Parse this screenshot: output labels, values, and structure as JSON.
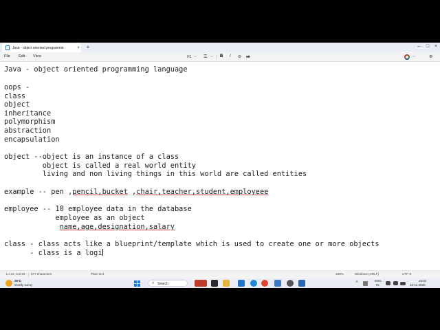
{
  "window": {
    "tab_title": "Java - object oriented programmir",
    "tab_close": "×",
    "new_tab": "+",
    "minimize": "–",
    "maximize": "□",
    "close": "×"
  },
  "menu": {
    "items": [
      "File",
      "Edit",
      "View"
    ],
    "heading_select": "H1",
    "chevron": "⌵",
    "bullet_list": "☰",
    "bold": "B",
    "italic": "I",
    "link": "⊖",
    "strikethrough": "ab",
    "settings": "⚙"
  },
  "editor": {
    "lines": [
      {
        "text": "Java - object oriented programming language",
        "row": 0,
        "indent": 0
      },
      {
        "text": "oops -",
        "row": 2,
        "indent": 0
      },
      {
        "text": "class",
        "row": 3,
        "indent": 0
      },
      {
        "text": "object",
        "row": 4,
        "indent": 0
      },
      {
        "text": "inheritance",
        "row": 5,
        "indent": 0
      },
      {
        "text": "polymorphism",
        "row": 6,
        "indent": 0
      },
      {
        "text": "abstraction",
        "row": 7,
        "indent": 0
      },
      {
        "text": "encapsulation",
        "row": 8,
        "indent": 0
      },
      {
        "text": "object --object is an instance of a class",
        "row": 10,
        "indent": 0
      },
      {
        "text": "         object is called a real world entity",
        "row": 11,
        "indent": 0
      },
      {
        "text": "         living and non living things in this world are called entities",
        "row": 12,
        "indent": 0
      },
      {
        "text": "example -- pen ,",
        "row": 14,
        "indent": 0,
        "underlined": "pencil,bucket",
        "mid": " ,",
        "underlined2": "chair,teacher,student,employeee"
      },
      {
        "text": "employee -- 10 employee data in the database",
        "row": 16,
        "indent": 0
      },
      {
        "text": "            employee as an object",
        "row": 17,
        "indent": 0
      },
      {
        "text": "             ",
        "row": 18,
        "indent": 0,
        "underlined": "name,age,designation,salary"
      },
      {
        "text": "class - class acts like a blueprint/template which is used to create one or more objects",
        "row": 20,
        "indent": 0
      },
      {
        "text": "      - class is a logi",
        "row": 21,
        "indent": 0,
        "caret": true
      }
    ]
  },
  "status": {
    "position": "Ln 22, Col 23",
    "characters": "577 characters",
    "format": "Plain text",
    "zoom": "100%",
    "line_ending": "Windows (CRLF)",
    "encoding": "UTF-8"
  },
  "taskbar": {
    "temperature": "26°C",
    "weather": "Mostly sunny",
    "search_label": "Search",
    "search_icon": "⌕",
    "language_top": "ENG",
    "language_bottom": "IN",
    "time": "15:01",
    "date": "22-11-2025",
    "chevron": "˄"
  },
  "colors": {
    "spell_underline": "#d23b3b",
    "accent": "#1a7ad9",
    "titlebar": "#e9eef6"
  }
}
